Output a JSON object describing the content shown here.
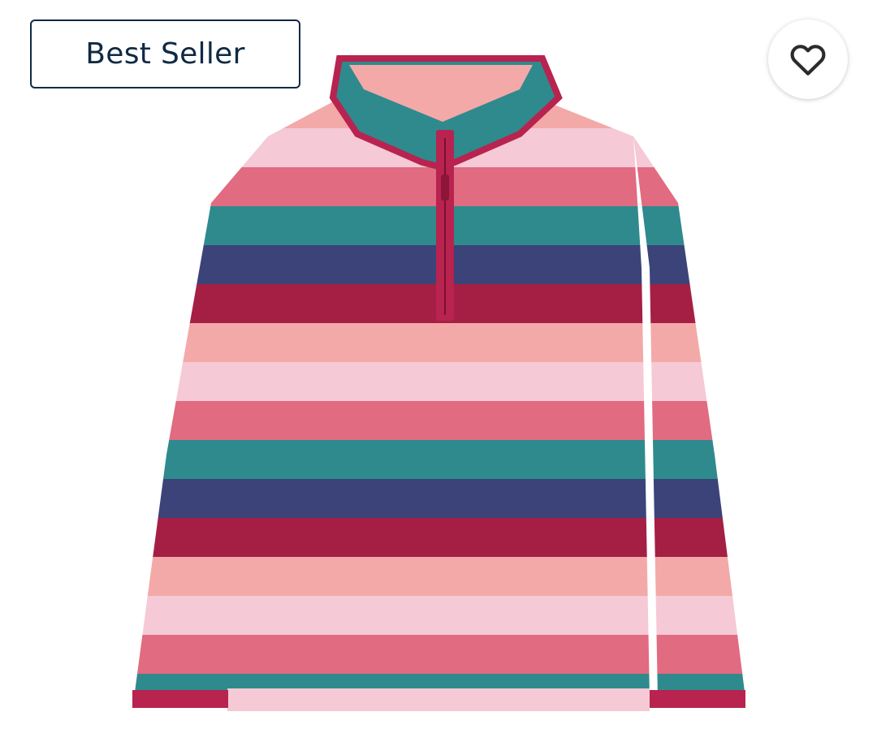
{
  "badge": {
    "label": "Best Seller"
  },
  "favorite": {
    "icon": "heart-outline-icon"
  },
  "product": {
    "icon": "striped-quarter-zip-fleece-image",
    "stripe_colors": [
      "#f3a9a8",
      "#f5c9d6",
      "#e16b80",
      "#2f8a8d",
      "#3b4379",
      "#a51f44"
    ],
    "trim_color": "#b8234f"
  }
}
